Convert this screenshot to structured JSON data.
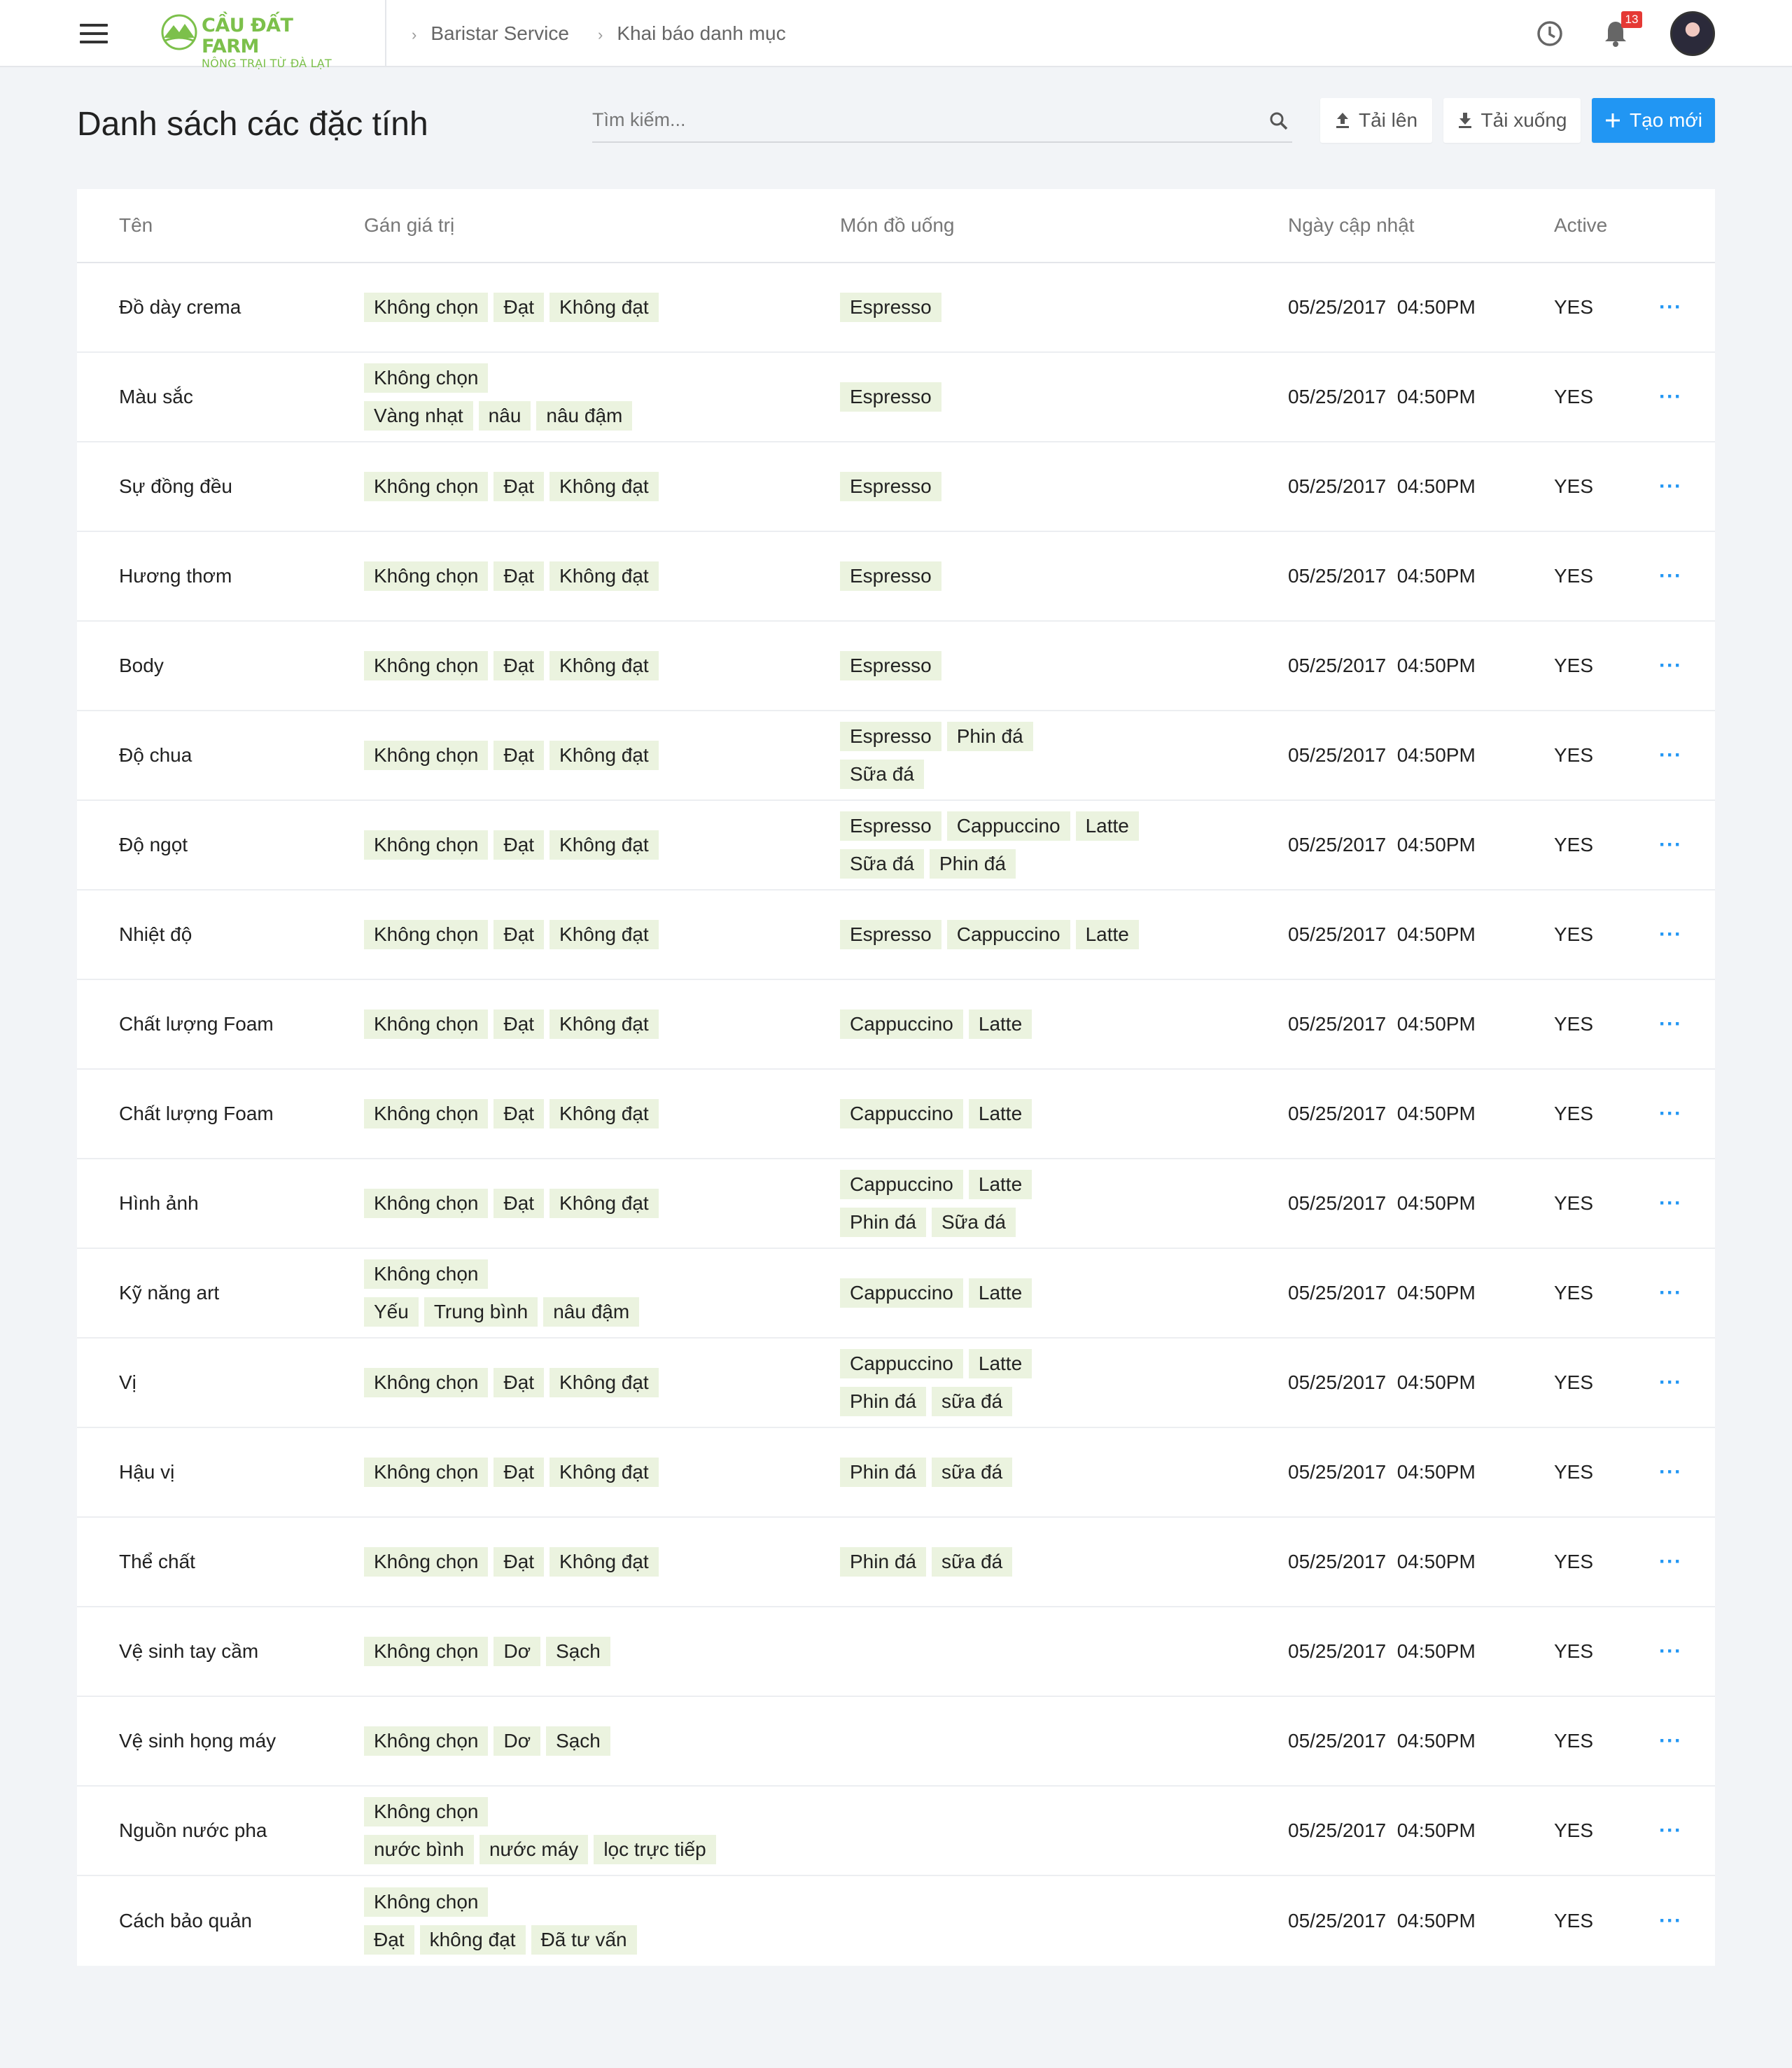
{
  "brand": {
    "name": "CẦU ĐẤT FARM",
    "tagline": "NÔNG TRẠI TỪ ĐÀ LẠT"
  },
  "breadcrumb": [
    "Baristar Service",
    "Khai báo danh mục"
  ],
  "header": {
    "notification_count": "13",
    "icons": [
      "menu-icon",
      "history-icon",
      "bell-icon"
    ]
  },
  "page": {
    "title": "Danh sách các đặc tính"
  },
  "search": {
    "placeholder": "Tìm kiếm..."
  },
  "actions": {
    "upload": "Tải lên",
    "download": "Tải xuống",
    "create": "Tạo mới"
  },
  "colors": {
    "primary": "#2196f3",
    "tag_bg": "#ebf3df",
    "brand_green": "#7cc04b",
    "badge": "#e53935"
  },
  "table": {
    "columns": [
      "Tên",
      "Gán giá trị",
      "Món đồ uống",
      "Ngày cập nhật",
      "Active"
    ],
    "more_label": "···",
    "rows": [
      {
        "name": "Đồ dày crema",
        "values": [
          [
            "Không chọn",
            "Đạt",
            "Không đạt"
          ]
        ],
        "drinks": [
          [
            "Espresso"
          ]
        ],
        "updated": "05/25/2017  04:50PM",
        "active": "YES"
      },
      {
        "name": "Màu sắc",
        "values": [
          [
            "Không chọn"
          ],
          [
            "Vàng nhạt",
            "nâu",
            "nâu đậm"
          ]
        ],
        "drinks": [
          [
            "Espresso"
          ]
        ],
        "updated": "05/25/2017  04:50PM",
        "active": "YES"
      },
      {
        "name": "Sự đồng đều",
        "values": [
          [
            "Không chọn",
            "Đạt",
            "Không đạt"
          ]
        ],
        "drinks": [
          [
            "Espresso"
          ]
        ],
        "updated": "05/25/2017  04:50PM",
        "active": "YES"
      },
      {
        "name": "Hương thơm",
        "values": [
          [
            "Không chọn",
            "Đạt",
            "Không đạt"
          ]
        ],
        "drinks": [
          [
            "Espresso"
          ]
        ],
        "updated": "05/25/2017  04:50PM",
        "active": "YES"
      },
      {
        "name": "Body",
        "values": [
          [
            "Không chọn",
            "Đạt",
            "Không đạt"
          ]
        ],
        "drinks": [
          [
            "Espresso"
          ]
        ],
        "updated": "05/25/2017  04:50PM",
        "active": "YES"
      },
      {
        "name": "Độ chua",
        "values": [
          [
            "Không chọn",
            "Đạt",
            "Không đạt"
          ]
        ],
        "drinks": [
          [
            "Espresso",
            "Phin đá"
          ],
          [
            "Sữa đá"
          ]
        ],
        "updated": "05/25/2017  04:50PM",
        "active": "YES"
      },
      {
        "name": "Độ ngọt",
        "values": [
          [
            "Không chọn",
            "Đạt",
            "Không đạt"
          ]
        ],
        "drinks": [
          [
            "Espresso",
            "Cappuccino",
            "Latte"
          ],
          [
            "Sữa đá",
            "Phin đá"
          ]
        ],
        "updated": "05/25/2017  04:50PM",
        "active": "YES"
      },
      {
        "name": "Nhiệt độ",
        "values": [
          [
            "Không chọn",
            "Đạt",
            "Không đạt"
          ]
        ],
        "drinks": [
          [
            "Espresso",
            "Cappuccino",
            "Latte"
          ]
        ],
        "updated": "05/25/2017  04:50PM",
        "active": "YES"
      },
      {
        "name": "Chất lượng Foam",
        "values": [
          [
            "Không chọn",
            "Đạt",
            "Không đạt"
          ]
        ],
        "drinks": [
          [
            "Cappuccino",
            "Latte"
          ]
        ],
        "updated": "05/25/2017  04:50PM",
        "active": "YES"
      },
      {
        "name": "Chất lượng Foam",
        "values": [
          [
            "Không chọn",
            "Đạt",
            "Không đạt"
          ]
        ],
        "drinks": [
          [
            "Cappuccino",
            "Latte"
          ]
        ],
        "updated": "05/25/2017  04:50PM",
        "active": "YES"
      },
      {
        "name": "Hình ảnh",
        "values": [
          [
            "Không chọn",
            "Đạt",
            "Không đạt"
          ]
        ],
        "drinks": [
          [
            "Cappuccino",
            "Latte"
          ],
          [
            "Phin đá",
            "Sữa đá"
          ]
        ],
        "updated": "05/25/2017  04:50PM",
        "active": "YES"
      },
      {
        "name": "Kỹ năng art",
        "values": [
          [
            "Không chọn"
          ],
          [
            "Yếu",
            "Trung bình",
            "nâu đậm"
          ]
        ],
        "drinks": [
          [
            "Cappuccino",
            "Latte"
          ]
        ],
        "updated": "05/25/2017  04:50PM",
        "active": "YES"
      },
      {
        "name": "Vị",
        "values": [
          [
            "Không chọn",
            "Đạt",
            "Không đạt"
          ]
        ],
        "drinks": [
          [
            "Cappuccino",
            "Latte"
          ],
          [
            "Phin đá",
            "sữa đá"
          ]
        ],
        "updated": "05/25/2017  04:50PM",
        "active": "YES"
      },
      {
        "name": "Hậu vị",
        "values": [
          [
            "Không chọn",
            "Đạt",
            "Không đạt"
          ]
        ],
        "drinks": [
          [
            "Phin đá",
            "sữa đá"
          ]
        ],
        "updated": "05/25/2017  04:50PM",
        "active": "YES"
      },
      {
        "name": "Thể chất",
        "values": [
          [
            "Không chọn",
            "Đạt",
            "Không đạt"
          ]
        ],
        "drinks": [
          [
            "Phin đá",
            "sữa đá"
          ]
        ],
        "updated": "05/25/2017  04:50PM",
        "active": "YES"
      },
      {
        "name": "Vệ sinh tay cầm",
        "values": [
          [
            "Không chọn",
            "Dơ",
            "Sạch"
          ]
        ],
        "drinks": [],
        "updated": "05/25/2017  04:50PM",
        "active": "YES"
      },
      {
        "name": "Vệ sinh họng máy",
        "values": [
          [
            "Không chọn",
            "Dơ",
            "Sạch"
          ]
        ],
        "drinks": [],
        "updated": "05/25/2017  04:50PM",
        "active": "YES"
      },
      {
        "name": "Nguồn nước pha",
        "values": [
          [
            "Không chọn"
          ],
          [
            "nước bình",
            "nước máy",
            "lọc trực tiếp"
          ]
        ],
        "drinks": [],
        "updated": "05/25/2017  04:50PM",
        "active": "YES"
      },
      {
        "name": "Cách bảo quản",
        "values": [
          [
            "Không chọn"
          ],
          [
            "Đạt",
            "không đạt",
            "Đã tư vấn"
          ]
        ],
        "drinks": [],
        "updated": "05/25/2017  04:50PM",
        "active": "YES"
      }
    ]
  }
}
